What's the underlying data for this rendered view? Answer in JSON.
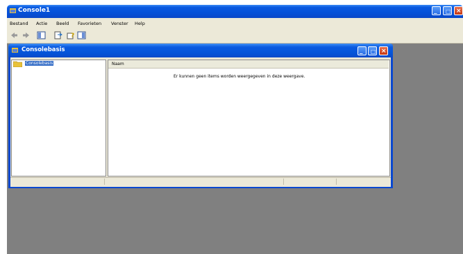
{
  "app": {
    "title": "Console1"
  },
  "menu": [
    "Bestand",
    "Actie",
    "Beeld",
    "Favorieten",
    "Venster",
    "Help"
  ],
  "child": {
    "title": "Consolebasis",
    "tree_item": "Consolebasis",
    "column_header": "Naam",
    "empty_message": "Er kunnen geen items worden weergegeven in deze weergave."
  },
  "colors": {
    "titlebar": "#0a5ae0",
    "chrome": "#ece9d8",
    "workspace": "#808080",
    "selection": "#316ac5",
    "close": "#c63812"
  },
  "icons": {
    "app": "console-icon",
    "toolbar": [
      "back-icon",
      "forward-icon",
      "show-hide-console-tree-icon",
      "export-list-icon",
      "help-icon",
      "show-hide-action-pane-icon"
    ]
  }
}
